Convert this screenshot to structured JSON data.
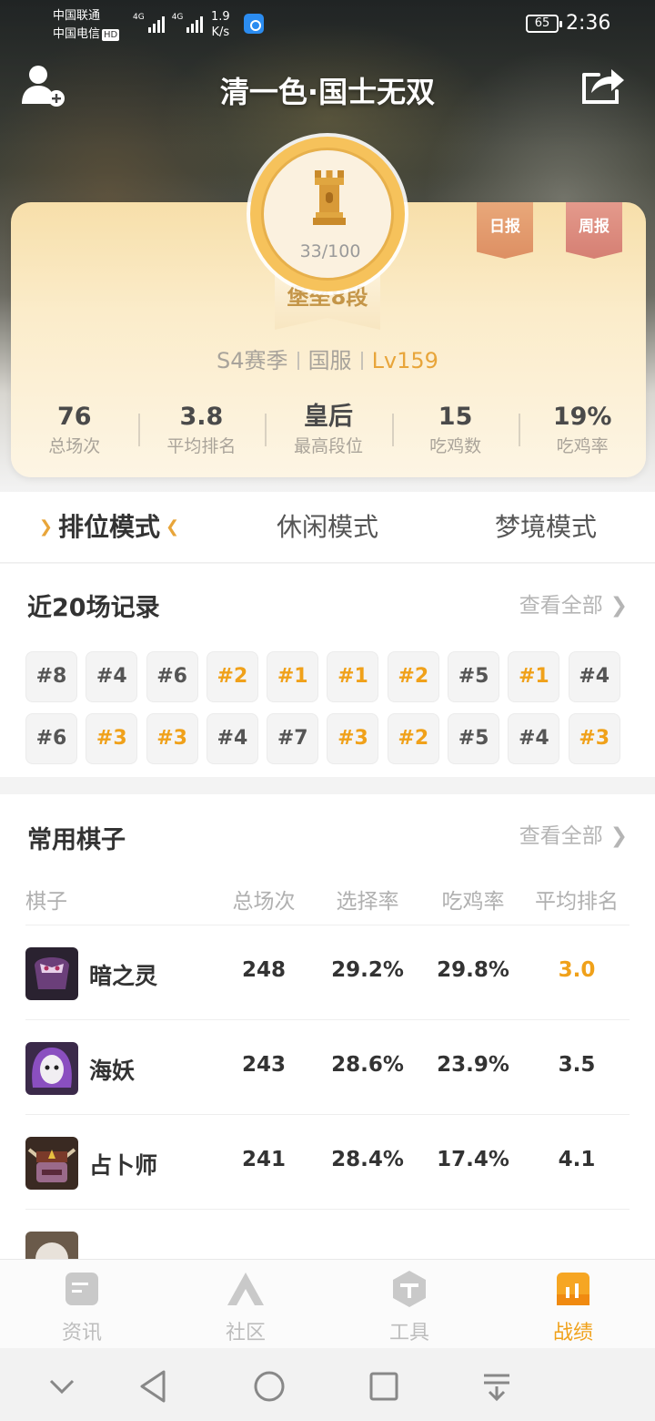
{
  "status_bar": {
    "carrier_1": "中国联通",
    "carrier_2": "中国电信",
    "hd": "HD",
    "signal_label": "4G",
    "net_speed_value": "1.9",
    "net_speed_unit": "K/s",
    "battery": "65",
    "time": "2:36"
  },
  "header": {
    "title": "清一色·国士无双",
    "add_friend_icon": "add-friend-icon",
    "share_icon": "share-icon"
  },
  "profile": {
    "rank_progress": "33/100",
    "tier": "堡垒8段",
    "daily_report": "日报",
    "weekly_report": "周报",
    "season": "S4赛季",
    "server": "国服",
    "level": "Lv159",
    "stats": [
      {
        "value": "76",
        "label": "总场次"
      },
      {
        "value": "3.8",
        "label": "平均排名"
      },
      {
        "value": "皇后",
        "label": "最高段位"
      },
      {
        "value": "15",
        "label": "吃鸡数"
      },
      {
        "value": "19%",
        "label": "吃鸡率"
      }
    ]
  },
  "modes": {
    "tabs": [
      "排位模式",
      "休闲模式",
      "梦境模式"
    ],
    "active_index": 0
  },
  "recent": {
    "title": "近20场记录",
    "view_all": "查看全部",
    "placements": [
      "#8",
      "#4",
      "#6",
      "#2",
      "#1",
      "#1",
      "#2",
      "#5",
      "#1",
      "#4",
      "#6",
      "#3",
      "#3",
      "#4",
      "#7",
      "#3",
      "#2",
      "#5",
      "#4",
      "#3"
    ],
    "highlight_color": "#f0a11a"
  },
  "pieces": {
    "title": "常用棋子",
    "view_all": "查看全部",
    "columns": [
      "棋子",
      "总场次",
      "选择率",
      "吃鸡率",
      "平均排名"
    ],
    "rows": [
      {
        "name": "暗之灵",
        "games": "248",
        "pick_rate": "29.2%",
        "win_rate": "29.8%",
        "avg_rank": "3.0"
      },
      {
        "name": "海妖",
        "games": "243",
        "pick_rate": "28.6%",
        "win_rate": "23.9%",
        "avg_rank": "3.5"
      },
      {
        "name": "占卜师",
        "games": "241",
        "pick_rate": "28.4%",
        "win_rate": "17.4%",
        "avg_rank": "4.1"
      }
    ]
  },
  "bottom_nav": {
    "items": [
      {
        "label": "资讯",
        "icon": "news-icon"
      },
      {
        "label": "社区",
        "icon": "community-icon"
      },
      {
        "label": "工具",
        "icon": "tools-icon"
      },
      {
        "label": "战绩",
        "icon": "record-icon"
      }
    ],
    "active_index": 3,
    "accent": "#f0a11a"
  },
  "system_nav": [
    "collapse-icon",
    "back-icon",
    "home-icon",
    "recents-icon",
    "notification-icon"
  ]
}
